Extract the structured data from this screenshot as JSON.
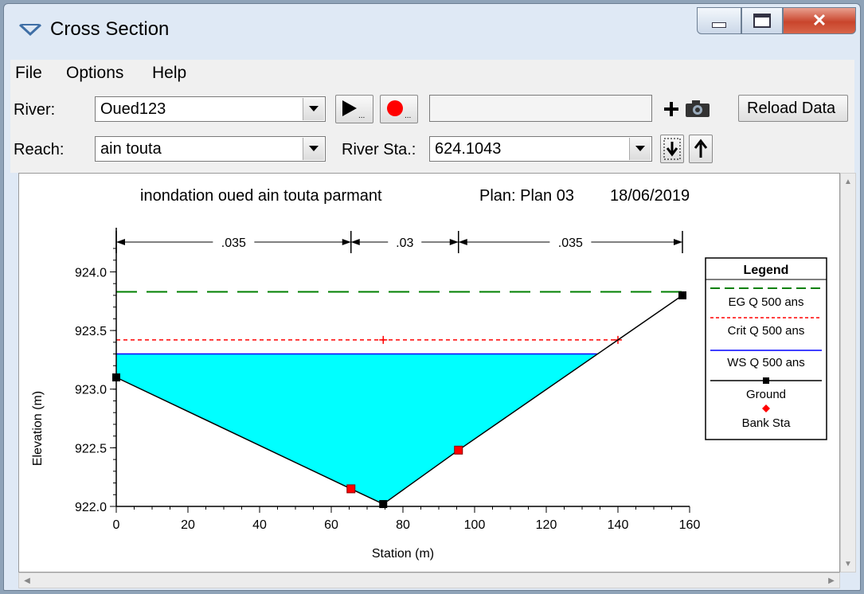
{
  "window": {
    "title": "Cross Section"
  },
  "menu": [
    "File",
    "Options",
    "Help"
  ],
  "toolbar": {
    "river_label": "River:",
    "river_value": "Oued123",
    "reach_label": "Reach:",
    "reach_value": "ain touta",
    "river_sta_label": "River Sta.:",
    "river_sta_value": "624.1043",
    "plot_name_value": "",
    "reload_label": "Reload Data"
  },
  "plot": {
    "header_title": "inondation oued ain touta parmant",
    "header_plan": "Plan: Plan 03",
    "header_date": "18/06/2019",
    "legend_title": "Legend"
  },
  "colors": {
    "water": "#00ffff",
    "eg_line": "#008000",
    "crit_line": "#ff0000",
    "ws_line": "#0000ff",
    "ground": "#000000",
    "bank": "#ff0000"
  },
  "icons": [
    "window-menu-icon",
    "minimize-icon",
    "maximize-icon",
    "close-icon",
    "dropdown-arrow-icon",
    "play-icon",
    "record-icon",
    "plus-icon",
    "camera-icon",
    "download-icon",
    "up-arrow-icon"
  ],
  "chart_data": {
    "type": "line",
    "title": "inondation oued ain touta parmant",
    "xlabel": "Station (m)",
    "ylabel": "Elevation (m)",
    "xlim": [
      0,
      160
    ],
    "ylim": [
      922.0,
      924.2
    ],
    "xticks": [
      0,
      20,
      40,
      60,
      80,
      100,
      120,
      140,
      160
    ],
    "yticks": [
      922.0,
      922.5,
      923.0,
      923.5,
      924.0
    ],
    "xtick_labels": [
      "0",
      "20",
      "40",
      "60",
      "80",
      "100",
      "120",
      "140",
      "160"
    ],
    "ytick_labels": [
      "922.0",
      "922.5",
      "923.0",
      "923.5",
      "924.0"
    ],
    "ground": {
      "x": [
        0,
        65.5,
        74.5,
        95.5,
        158
      ],
      "y": [
        923.1,
        922.15,
        922.02,
        922.48,
        923.8
      ]
    },
    "ground_points": {
      "x": [
        0,
        74.5,
        158
      ],
      "y": [
        923.1,
        922.02,
        923.8
      ]
    },
    "bank_sta": {
      "x": [
        65.5,
        95.5
      ],
      "y": [
        922.15,
        922.48
      ]
    },
    "ws_elevation": 923.3,
    "crit_elevation": 923.42,
    "crit_marks_x": [
      74.5,
      140
    ],
    "eg_elevation": 923.83,
    "mannings": [
      {
        "from": 0,
        "to": 65.5,
        "label": ".035"
      },
      {
        "from": 65.5,
        "to": 95.5,
        "label": ".03"
      },
      {
        "from": 95.5,
        "to": 158,
        "label": ".035"
      }
    ],
    "legend": [
      "EG Q 500 ans",
      "Crit Q 500 ans",
      "WS Q 500 ans",
      "Ground",
      "Bank Sta"
    ],
    "legend_placement": "right",
    "grid": false
  }
}
